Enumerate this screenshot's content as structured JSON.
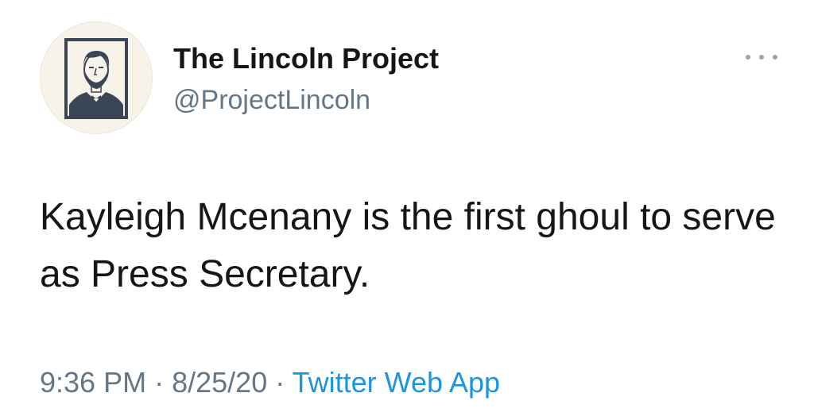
{
  "tweet": {
    "author": {
      "name": "The Lincoln Project",
      "handle": "@ProjectLincoln",
      "avatar": "lincoln-portrait-icon"
    },
    "more_icon": "more-options-icon",
    "text": "Kayleigh Mcenany is the first ghoul to serve as Press Secretary.",
    "time": "9:36 PM",
    "separator": "·",
    "date": "8/25/20",
    "source": "Twitter Web App"
  },
  "colors": {
    "text": "#14171a",
    "secondary": "#657786",
    "link": "#1b95e0",
    "avatar_bg": "#f7f3e9",
    "avatar_ink": "#3a4556"
  }
}
